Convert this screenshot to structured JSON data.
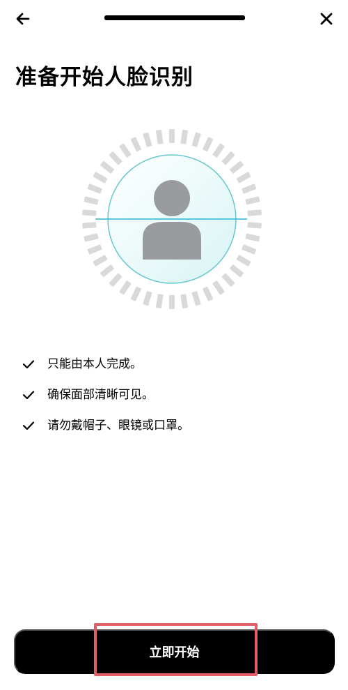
{
  "header": {
    "back_icon": "arrow-left-icon",
    "close_icon": "close-icon",
    "progress": 1
  },
  "page": {
    "title": "准备开始人脸识别"
  },
  "tips": [
    {
      "text": "只能由本人完成。",
      "icon": "check-icon"
    },
    {
      "text": "确保面部清晰可见。",
      "icon": "check-icon"
    },
    {
      "text": "请勿戴帽子、眼镜或口罩。",
      "icon": "check-icon"
    }
  ],
  "action": {
    "start_label": "立即开始"
  },
  "colors": {
    "button_background": "#000000",
    "button_text": "#ffffff",
    "scan_line": "#2bb5c9",
    "avatar": "#999b9f",
    "ring_ticks": "#d9d9d9",
    "highlight": "#e05f66"
  }
}
